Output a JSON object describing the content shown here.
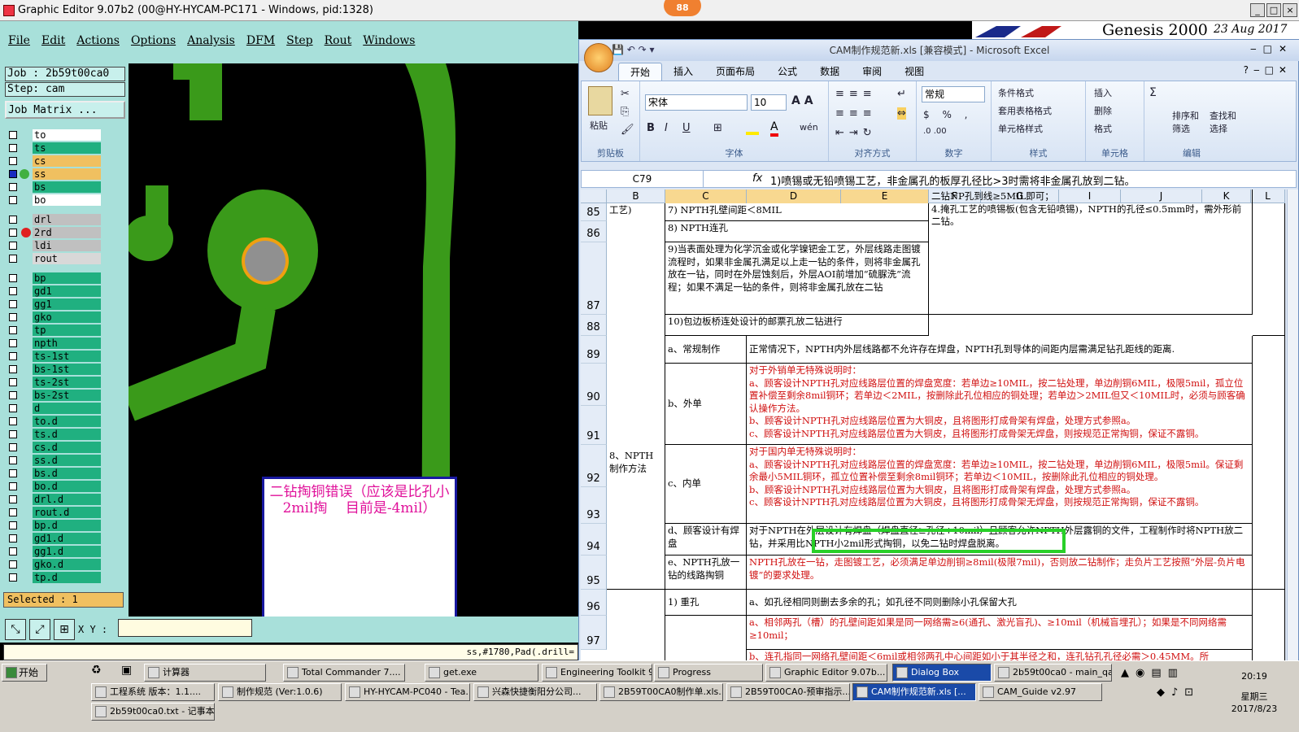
{
  "ge": {
    "title": "Graphic Editor 9.07b2 (00@HY-HYCAM-PC171 - Windows, pid:1328)",
    "badge": "88",
    "menu": [
      "File",
      "Edit",
      "Actions",
      "Options",
      "Analysis",
      "DFM",
      "Step",
      "Rout",
      "Windows"
    ],
    "header_right": "Genesis 2000",
    "date": "23  Aug  2017",
    "job": "Job : 2b59t00ca0",
    "step": "Step: cam",
    "job_matrix": "Job Matrix ...",
    "layers": [
      {
        "name": "to",
        "color": "#ffffff"
      },
      {
        "name": "ts",
        "color": "#20b080"
      },
      {
        "name": "cs",
        "color": "#f0c060"
      },
      {
        "name": "ss",
        "color": "#f0c060"
      },
      {
        "name": "bs",
        "color": "#20b080"
      },
      {
        "name": "bo",
        "color": "#ffffff"
      }
    ],
    "layers2": [
      {
        "name": "drl",
        "color": "#c0c0c0"
      },
      {
        "name": "2rd",
        "color": "#c0c0c0"
      },
      {
        "name": "ldi",
        "color": "#c0c0c0"
      },
      {
        "name": "rout",
        "color": "#d8d8d8"
      }
    ],
    "layers3": [
      "bp",
      "gd1",
      "gg1",
      "gko",
      "tp",
      "npth",
      "ts-1st",
      "bs-1st",
      "ts-2st",
      "bs-2st",
      "d",
      "to.d",
      "ts.d",
      "cs.d",
      "ss.d",
      "bs.d",
      "bo.d",
      "drl.d",
      "rout.d",
      "bp.d",
      "gd1.d",
      "gg1.d",
      "gko.d",
      "tp.d"
    ],
    "selected": "Selected : 1",
    "xy_label": "X Y :",
    "status": "ss,#1780,Pad(.drill=",
    "note": "二钻掏铜错误（应该是比孔小2mil掏　 目前是-4mil）"
  },
  "xl": {
    "title": "CAM制作规范新.xls  [兼容模式] - Microsoft Excel",
    "tabs": [
      "开始",
      "插入",
      "页面布局",
      "公式",
      "数据",
      "审阅",
      "视图"
    ],
    "ribbon": {
      "paste": "粘贴",
      "clipboard": "剪贴板",
      "font_name": "宋体",
      "font_size": "10",
      "font_group": "字体",
      "align_group": "对齐方式",
      "number_format": "常规",
      "number_group": "数字",
      "cond_format": "条件格式",
      "table_format": "套用表格格式",
      "cell_style": "单元格样式",
      "style_group": "样式",
      "insert": "插入",
      "delete": "删除",
      "format": "格式",
      "cells_group": "单元格",
      "sort_filter": "排序和筛选",
      "find_select": "查找和选择",
      "edit_group": "编辑"
    },
    "name_box": "C79",
    "formula": "1)喷锡或无铅喷锡工艺，非金属孔的板厚孔径比>3时需将非金属孔放到二钻。",
    "columns": [
      "B",
      "C",
      "D",
      "E",
      "F",
      "G",
      "I",
      "J",
      "K",
      "L"
    ],
    "rows": {
      "r85_b": "工艺)",
      "r85_c": "7) NPTH孔壁间距＜8MIL",
      "r86_c": "8) NPTH连孔",
      "r87_c": "9)当表面处理为化学沉金或化学镍钯金工艺，外层线路走图镀流程时，如果非金属孔满足以上走一钻的条件，则将非金属孔放在一钻，同时在外层蚀刻后，外层AOI前增加“硫脲洗”流程；如果不满足一钻的条件，则将非金属孔放在二钻",
      "r88_c": "10)包边板桥连处设计的邮票孔放二钻进行",
      "f_note": "二钻NP孔到线≥5MIL即可；\n4.掩孔工艺的喷锡板(包含无铅喷锡)，NPTH的孔径≤0.5mm时，需外形前二钻。",
      "b_npth": "8、NPTH制作方法",
      "r89_c": "a、常规制作",
      "r89_d": "正常情况下，NPTH内外层线路都不允许存在焊盘，NPTH孔到导体的间距内层需满足钻孔距线的距离.",
      "r90_c": "b、外单",
      "r90_d": "对于外销单无特殊说明时：\na、顾客设计NPTH孔对应线路层位置的焊盘宽度：若单边≥10MIL，按二钻处理，单边削铜6MIL，极限5mil，孤立位置补偿至剩余8mil铜环；若单边＜2MIL，按删除此孔位相应的铜处理；若单边＞2MIL但又＜10MIL时，必须与顾客确认操作方法。\nb、顾客设计NPTH孔对应线路层位置为大铜皮，且将图形打成骨架有焊盘，处理方式参照a。\nc、顾客设计NPTH孔对应线路层位置为大铜皮，且将图形打成骨架无焊盘，则按规范正常掏铜，保证不露铜。",
      "r92_c": "c、内单",
      "r92_d": "对于国内单无特殊说明时：\na、顾客设计NPTH孔对应线路层位置的焊盘宽度：若单边≥10MIL，按二钻处理，单边削铜6MIL，极限5mil。保证剩余最小5MIL铜环，孤立位置补偿至剩余8mil铜环；若单边＜10MIL，按删除此孔位相应的铜处理。\nb、顾客设计NPTH孔对应线路层位置为大铜皮，且将图形打成骨架有焊盘，处理方式参照a。\nc、顾客设计NPTH孔对应线路层位置为大铜皮，且将图形打成骨架无焊盘，则按规范正常掏铜，保证不露铜。",
      "r94_c": "d、顾客设计有焊盘",
      "r94_d": "对于NPTH在外层设计有焊盘（焊盘直径≥孔径+10mil）且顾客允许NPTH外层露铜的文件，工程制作时将NPTH放二钻，并采用比NPTH小2mil形式掏铜，以免二钻时焊盘脱离。",
      "r95_c": "e、NPTH孔放一钻的线路掏铜",
      "r95_d": "NPTH孔放在一钻，走图镀工艺，必须满足单边削铜≥8mil(极限7mil)，否则放二钻制作；走负片工艺按照“外层-负片电镀”的要求处理。",
      "r96_c": "1) 重孔",
      "r96_d": "a、如孔径相同则删去多余的孔；如孔径不同则删除小孔保留大孔",
      "r97_d": "a、相邻两孔（槽）的孔壁间距如果是同一网络需≥6(通孔、激光盲孔)、≥10mil（机械盲埋孔）；如果是不同网络需≥10mil；",
      "r98_d": "b、连孔指同一网络孔壁间距＜6mil或相邻两孔中心间距如小于其半径之和，连孔钻孔孔径必需＞0.45MM。所"
    },
    "row_numbers": [
      "85",
      "86",
      "87",
      "88",
      "89",
      "90",
      "91",
      "92",
      "93",
      "94",
      "95",
      "96",
      "97"
    ]
  },
  "taskbar": {
    "start": "开始",
    "row1": [
      "计算器",
      "Total Commander 7....",
      "get.exe",
      "Engineering Toolkit 9...",
      "Progress",
      "Graphic Editor 9.07b...",
      "Dialog Box",
      "2b59t00ca0 - main_qa"
    ],
    "row2": [
      "工程系统  版本：1.1....",
      "制作规范 (Ver:1.0.6)",
      "HY-HYCAM-PC040 - Tea...",
      "兴森快捷衡阳分公司...",
      "2B59T00CA0制作单.xls...",
      "2B59T00CA0-预审指示...",
      "CAM制作规范新.xls [...",
      "CAM_Guide v2.97"
    ],
    "row3": [
      "2b59t00ca0.txt - 记事本"
    ],
    "time": "20:19",
    "weekday": "星期三",
    "date": "2017/8/23"
  }
}
